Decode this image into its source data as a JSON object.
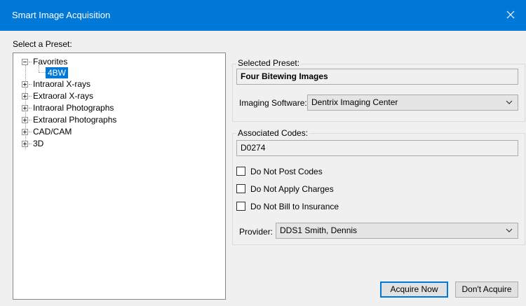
{
  "window": {
    "title": "Smart Image Acquisition"
  },
  "preset_panel": {
    "label": "Select a Preset:",
    "tree": [
      {
        "label": "Favorites",
        "expanded": true,
        "children": [
          {
            "label": "4BW",
            "selected": true
          }
        ]
      },
      {
        "label": "Intraoral X-rays",
        "expanded": false
      },
      {
        "label": "Extraoral X-rays",
        "expanded": false
      },
      {
        "label": "Intraoral Photographs",
        "expanded": false
      },
      {
        "label": "Extraoral Photographs",
        "expanded": false
      },
      {
        "label": "CAD/CAM",
        "expanded": false
      },
      {
        "label": "3D",
        "expanded": false
      }
    ]
  },
  "selected_preset": {
    "group_title": "Selected Preset:",
    "name": "Four Bitewing Images",
    "imaging_software_label": "Imaging Software:",
    "imaging_software_value": "Dentrix Imaging Center"
  },
  "associated_codes": {
    "group_title": "Associated Codes:",
    "codes": "D0274",
    "do_not_post_codes": {
      "label": "Do Not Post Codes",
      "checked": false
    },
    "do_not_apply_charges": {
      "label": "Do Not Apply Charges",
      "checked": false
    },
    "do_not_bill_insurance": {
      "label": "Do Not Bill to Insurance",
      "checked": false
    },
    "provider_label": "Provider:",
    "provider_value": "DDS1 Smith, Dennis"
  },
  "buttons": {
    "acquire_now": "Acquire Now",
    "dont_acquire": "Don't Acquire"
  },
  "colors": {
    "titlebar": "#0078d7",
    "selection": "#0078d7",
    "window_bg": "#f0f0f0"
  }
}
